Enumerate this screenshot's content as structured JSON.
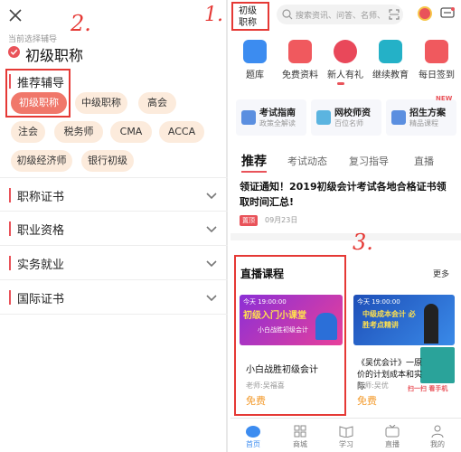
{
  "left": {
    "current_label": "当前选择辅导",
    "current_value": "初级职称",
    "recommend_title": "推荐辅导",
    "tags": [
      "初级职称",
      "中级职称",
      "高会",
      "注会",
      "税务师",
      "CMA",
      "ACCA",
      "初级经济师",
      "银行初级"
    ],
    "sections": [
      "职称证书",
      "职业资格",
      "实务就业",
      "国际证书"
    ]
  },
  "right": {
    "location_top": "初级",
    "location_bottom": "职称",
    "search_placeholder": "搜索资讯、问答、名师、...",
    "icons": [
      "题库",
      "免费资料",
      "新人有礼",
      "继续教育",
      "每日签到"
    ],
    "new_badge": "NEW",
    "features": [
      {
        "title": "考试指南",
        "sub": "政策全解读"
      },
      {
        "title": "网校师资",
        "sub": "百位名师"
      },
      {
        "title": "招生方案",
        "sub": "精品课程"
      }
    ],
    "tabs": [
      "推荐",
      "考试动态",
      "复习指导",
      "直播"
    ],
    "news_title": "领证通知！2019初级会计考试各地合格证书领取时间汇总!",
    "news_tag": "置顶",
    "news_date": "09月23日",
    "live_title": "直播课程",
    "live_more": "更多",
    "course1": {
      "thumb_time": "今天 19:00:00",
      "thumb_title": "初级入门小课堂",
      "thumb_sub": "小白战胜初级会计",
      "title": "小白战胜初级会计",
      "teacher": "老师:吴福喜",
      "price": "免费"
    },
    "course2": {
      "thumb_time": "今天 19:00:00",
      "thumb_title": "中级成本会计 必胜考点精讲",
      "thumb_qr": "扫一扫 看手机",
      "title": "《吴优会计》一原价的计划成本和实际",
      "teacher": "老师:吴优",
      "price": "免费"
    },
    "nav": [
      "首页",
      "商城",
      "学习",
      "直播",
      "我的"
    ]
  },
  "annotations": {
    "one": "1.",
    "two": "2.",
    "three": "3."
  },
  "colors": {
    "accent": "#e9535a",
    "tag_bg": "#fcebdc",
    "tag_active": "#f0776a",
    "annotation": "#e53935",
    "price": "#f39a2b"
  }
}
